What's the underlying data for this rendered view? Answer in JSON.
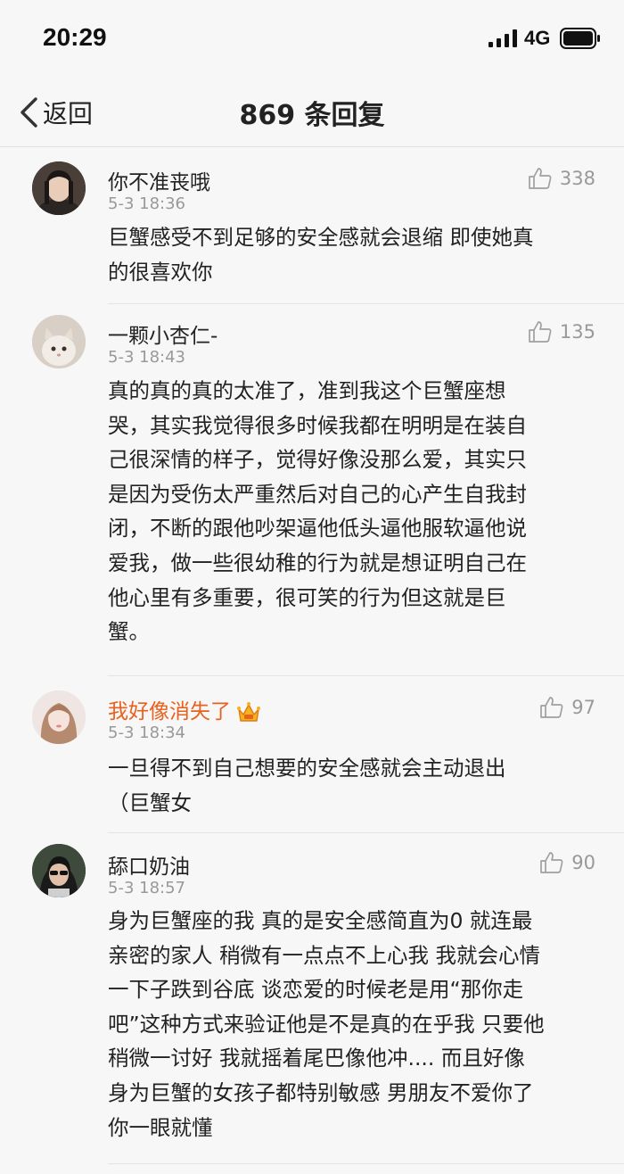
{
  "status_bar": {
    "time": "20:29",
    "network": "4G"
  },
  "nav": {
    "back_label": "返回",
    "title": "869 条回复"
  },
  "comments": [
    {
      "username": "你不准丧哦",
      "timestamp": "5-3 18:36",
      "likes": "338",
      "vip": false,
      "lines": [
        "巨蟹感受不到足够的安全感就会退缩 即使她真",
        "的很喜欢你"
      ]
    },
    {
      "username": "一颗小杏仁-",
      "timestamp": "5-3 18:43",
      "likes": "135",
      "vip": false,
      "lines": [
        "真的真的真的太准了，准到我这个巨蟹座想",
        "哭，其实我觉得很多时候我都在明明是在装自",
        "己很深情的样子，觉得好像没那么爱，其实只",
        "是因为受伤太严重然后对自己的心产生自我封",
        "闭，不断的跟他吵架逼他低头逼他服软逼他说",
        "爱我，做一些很幼稚的行为就是想证明自己在",
        "他心里有多重要，很可笑的行为但这就是巨",
        "蟹。"
      ]
    },
    {
      "username": "我好像消失了",
      "timestamp": "5-3 18:34",
      "likes": "97",
      "vip": true,
      "lines": [
        "一旦得不到自己想要的安全感就会主动退出",
        "（巨蟹女"
      ]
    },
    {
      "username": "舔口奶油",
      "timestamp": "5-3 18:57",
      "likes": "90",
      "vip": false,
      "lines": [
        "身为巨蟹座的我 真的是安全感简直为0 就连最",
        "亲密的家人 稍微有一点点不上心我 我就会心情",
        "一下子跌到谷底  谈恋爱的时候老是用“那你走",
        "吧”这种方式来验证他是不是真的在乎我 只要他",
        "稍微一讨好 我就摇着尾巴像他冲....  而且好像",
        "身为巨蟹的女孩子都特别敏感 男朋友不爱你了",
        "你一眼就懂"
      ]
    }
  ],
  "colors": {
    "background": "#f7f7f7",
    "text": "#222222",
    "meta": "#999999",
    "vip_name": "#e8611d",
    "divider": "#e4e4e4"
  },
  "icons": {
    "back": "chevron-left-icon",
    "like": "thumbs-up-icon",
    "crown": "crown-icon",
    "signal": "signal-bars-icon",
    "battery": "battery-icon"
  }
}
